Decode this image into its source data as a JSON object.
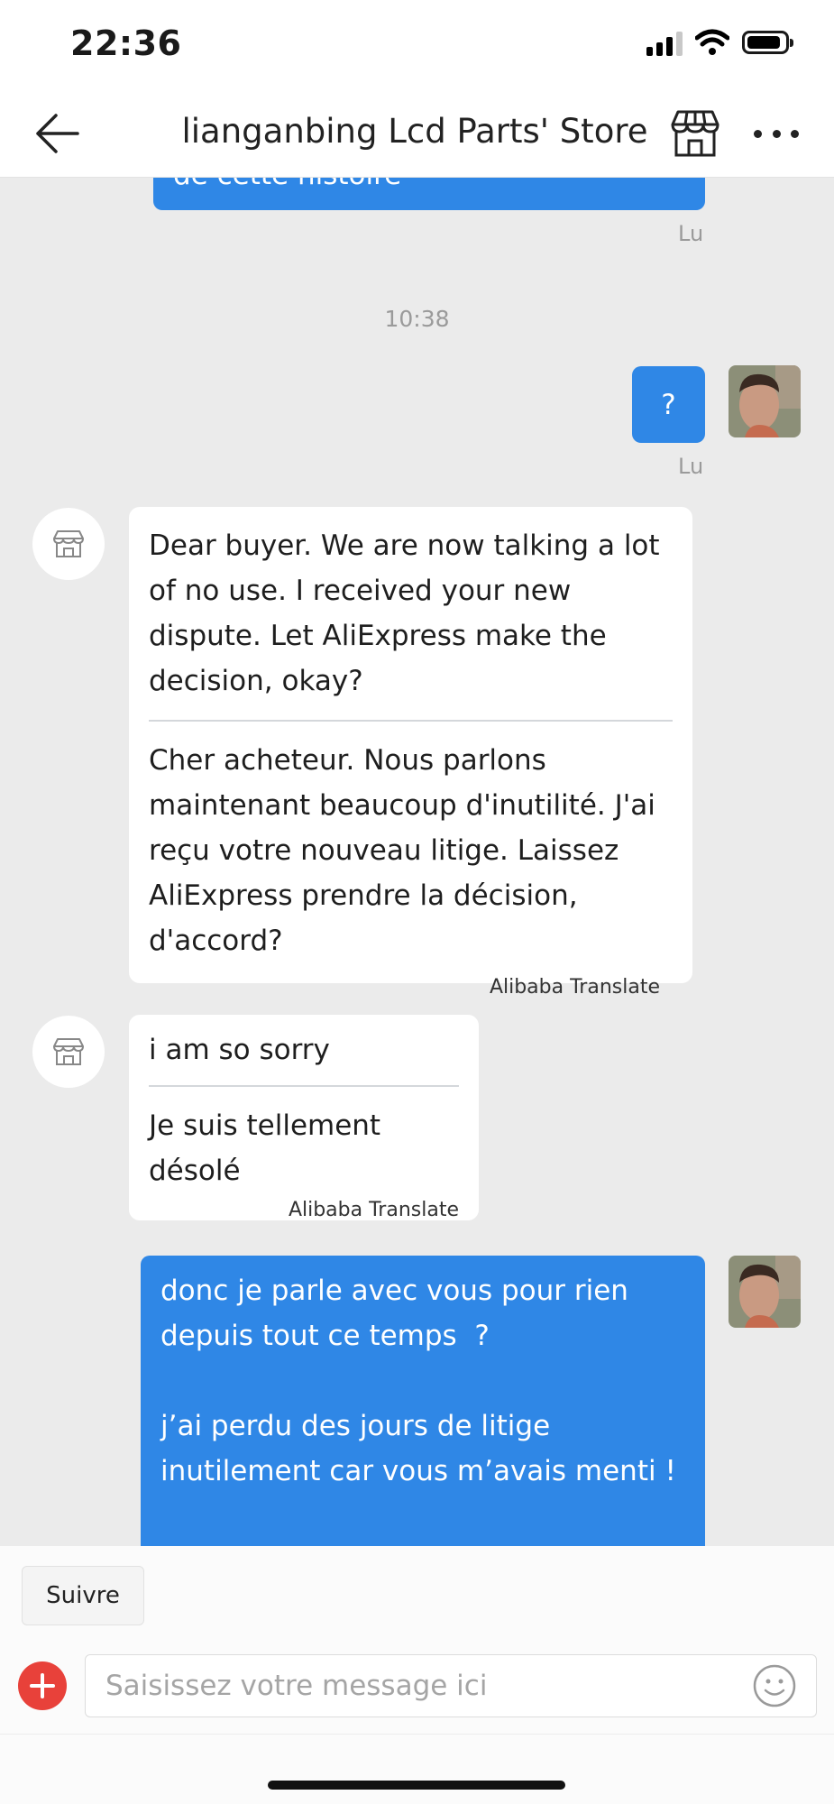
{
  "status_bar": {
    "time": "22:36"
  },
  "header": {
    "title": "lianganbing Lcd Parts' Store"
  },
  "chat": {
    "top_partial_text": "de cette histoire",
    "read_labels": [
      "Lu",
      "Lu"
    ],
    "timestamp": "10:38",
    "user_msg_1": "?",
    "seller_msg_1": {
      "original": "Dear buyer. We are now talking a lot of no use. I received your new dispute. Let AliExpress make the decision, okay?",
      "translated": "Cher acheteur. Nous parlons maintenant beaucoup d'inutilité. J'ai reçu votre nouveau litige. Laissez AliExpress prendre la décision, d'accord?",
      "translator": "Alibaba Translate"
    },
    "seller_msg_2": {
      "original": "i am so sorry",
      "translated": "Je suis tellement désolé",
      "translator": "Alibaba Translate"
    },
    "user_msg_2": "donc je parle avec vous pour rien depuis tout ce temps  ?\n\nj’ai perdu des jours de litige inutilement car vous m’avais menti !"
  },
  "bottom": {
    "follow_label": "Suivre",
    "input_placeholder": "Saisissez votre message ici"
  },
  "colors": {
    "accent_blue": "#2f87e6",
    "chat_background": "#ebebeb",
    "add_button": "#e8413a"
  },
  "icons": [
    "back-arrow-icon",
    "store-icon",
    "more-icon",
    "plus-icon",
    "emoji-icon",
    "wifi-icon",
    "signal-icon",
    "battery-icon"
  ]
}
